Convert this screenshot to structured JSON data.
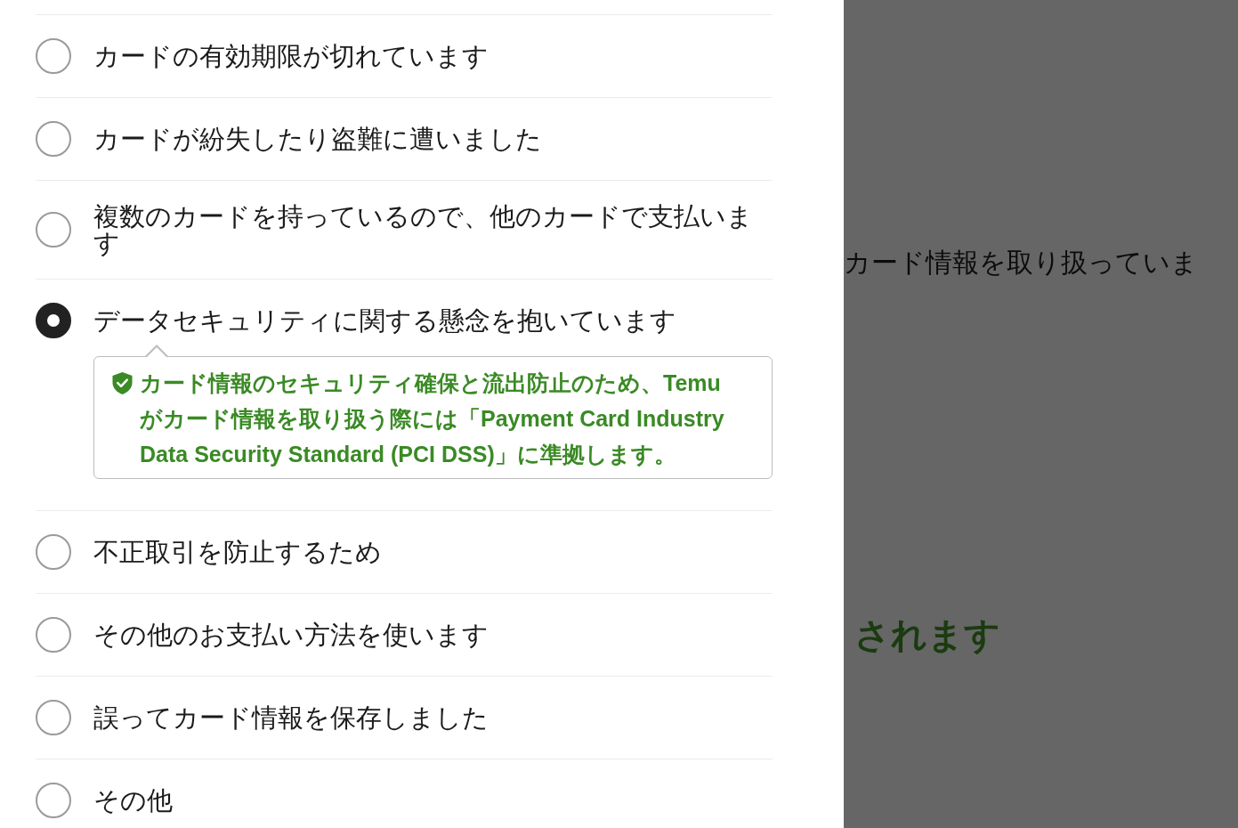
{
  "reasons": [
    {
      "label": "カードの有効期限が切れています",
      "selected": false
    },
    {
      "label": "カードが紛失したり盗難に遭いました",
      "selected": false
    },
    {
      "label": "複数のカードを持っているので、他のカードで支払います",
      "selected": false
    },
    {
      "label": "データセキュリティに関する懸念を抱いています",
      "selected": true,
      "note": "カード情報のセキュリティ確保と流出防止のため、Temuがカード情報を取り扱う際には「Payment Card Industry Data Security Standard (PCI DSS)」に準拠します。"
    },
    {
      "label": "不正取引を防止するため",
      "selected": false
    },
    {
      "label": "その他のお支払い方法を使います",
      "selected": false
    },
    {
      "label": "誤ってカード情報を保存しました",
      "selected": false
    },
    {
      "label": "その他",
      "selected": false
    }
  ],
  "background_page": {
    "texts": [
      {
        "kind": "body",
        "text": "カード情報を取り扱っていま"
      },
      {
        "kind": "heading",
        "text": "されます"
      }
    ]
  }
}
